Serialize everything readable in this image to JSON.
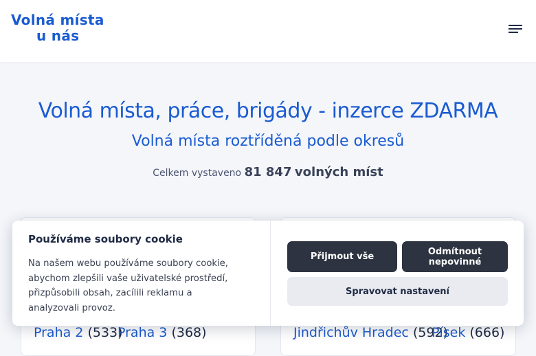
{
  "header": {
    "logo_line1": "Volná místa",
    "logo_line2": "u nás",
    "menu_icon": "hamburger-menu-icon"
  },
  "main": {
    "title": "Volná místa, práce, brigády - inzerce ZDARMA",
    "subtitle": "Volná místa roztříděná podle okresů",
    "stats_prefix": "Celkem vystaveno",
    "stats_count": "81 847",
    "stats_suffix": "volných míst"
  },
  "districts": [
    {
      "name": "Praha 2",
      "count": "(533)"
    },
    {
      "name": "Praha 3",
      "count": "(368)"
    },
    {
      "name": "Jindřichův Hradec",
      "count": "(592)"
    },
    {
      "name": "Písek",
      "count": "(666)"
    }
  ],
  "cookie": {
    "title": "Používáme soubory cookie",
    "text": "Na našem webu používáme soubory cookie, abychom zlepšili vaše uživatelské prostředí, přizpůsobili obsah, zacílili reklamu a analyzovali provoz.",
    "accept_label": "Přijmout vše",
    "reject_label": "Odmítnout nepovinné",
    "manage_label": "Spravovat nastavení"
  },
  "colors": {
    "brand": "#1a5bd0",
    "dark_button": "#2d3340",
    "light_button": "#e9ebf0"
  }
}
